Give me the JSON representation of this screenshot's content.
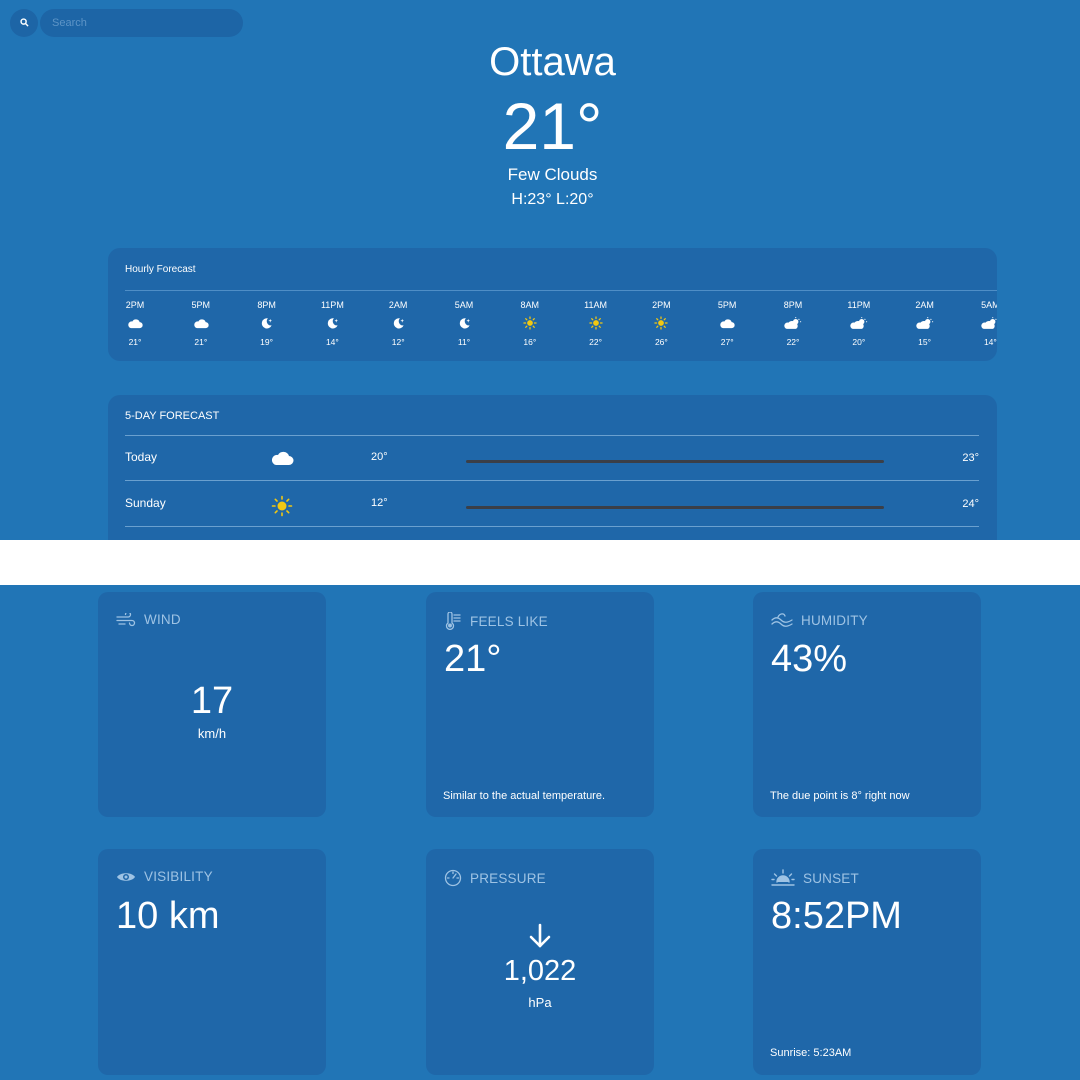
{
  "search": {
    "placeholder": "Search"
  },
  "header": {
    "city": "Ottawa",
    "temperature": "21°",
    "condition": "Few Clouds",
    "high_low": "H:23° L:20°"
  },
  "hourly": {
    "title": "Hourly Forecast",
    "items": [
      {
        "time": "2PM",
        "icon": "cloud-icon",
        "temp": "21°"
      },
      {
        "time": "5PM",
        "icon": "cloud-icon",
        "temp": "21°"
      },
      {
        "time": "8PM",
        "icon": "moon-star-icon",
        "temp": "19°"
      },
      {
        "time": "11PM",
        "icon": "moon-star-icon",
        "temp": "14°"
      },
      {
        "time": "2AM",
        "icon": "moon-star-icon",
        "temp": "12°"
      },
      {
        "time": "5AM",
        "icon": "moon-star-icon",
        "temp": "11°"
      },
      {
        "time": "8AM",
        "icon": "sun-icon",
        "temp": "16°"
      },
      {
        "time": "11AM",
        "icon": "sun-icon",
        "temp": "22°"
      },
      {
        "time": "2PM",
        "icon": "sun-icon",
        "temp": "26°"
      },
      {
        "time": "5PM",
        "icon": "cloud-icon",
        "temp": "27°"
      },
      {
        "time": "8PM",
        "icon": "cloud-sun-icon",
        "temp": "22°"
      },
      {
        "time": "11PM",
        "icon": "cloud-sun-icon",
        "temp": "20°"
      },
      {
        "time": "2AM",
        "icon": "cloud-sun-icon",
        "temp": "15°"
      },
      {
        "time": "5AM",
        "icon": "cloud-sun-icon",
        "temp": "14°"
      }
    ]
  },
  "five_day": {
    "title": "5-DAY FORECAST",
    "days": [
      {
        "day": "Today",
        "icon": "cloud-icon",
        "low": "20°",
        "high": "23°"
      },
      {
        "day": "Sunday",
        "icon": "sun-icon",
        "low": "12°",
        "high": "24°"
      }
    ]
  },
  "tiles": {
    "wind": {
      "label": "WIND",
      "value": "17",
      "unit": "km/h"
    },
    "feels_like": {
      "label": "FEELS LIKE",
      "value": "21°",
      "note": "Similar to the actual temperature."
    },
    "humidity": {
      "label": "HUMIDITY",
      "value": "43%",
      "note": "The due point is 8° right now"
    },
    "visibility": {
      "label": "VISIBILITY",
      "value": "10 km"
    },
    "pressure": {
      "label": "PRESSURE",
      "value": "1,022",
      "unit": "hPa"
    },
    "sunset": {
      "label": "SUNSET",
      "value": "8:52PM",
      "note": "Sunrise: 5:23AM"
    }
  },
  "colors": {
    "background": "#2175b6",
    "panel": "#1f67a9",
    "label": "#9ec3e4",
    "sun": "#f2c811",
    "bar": "#3b3f48"
  }
}
